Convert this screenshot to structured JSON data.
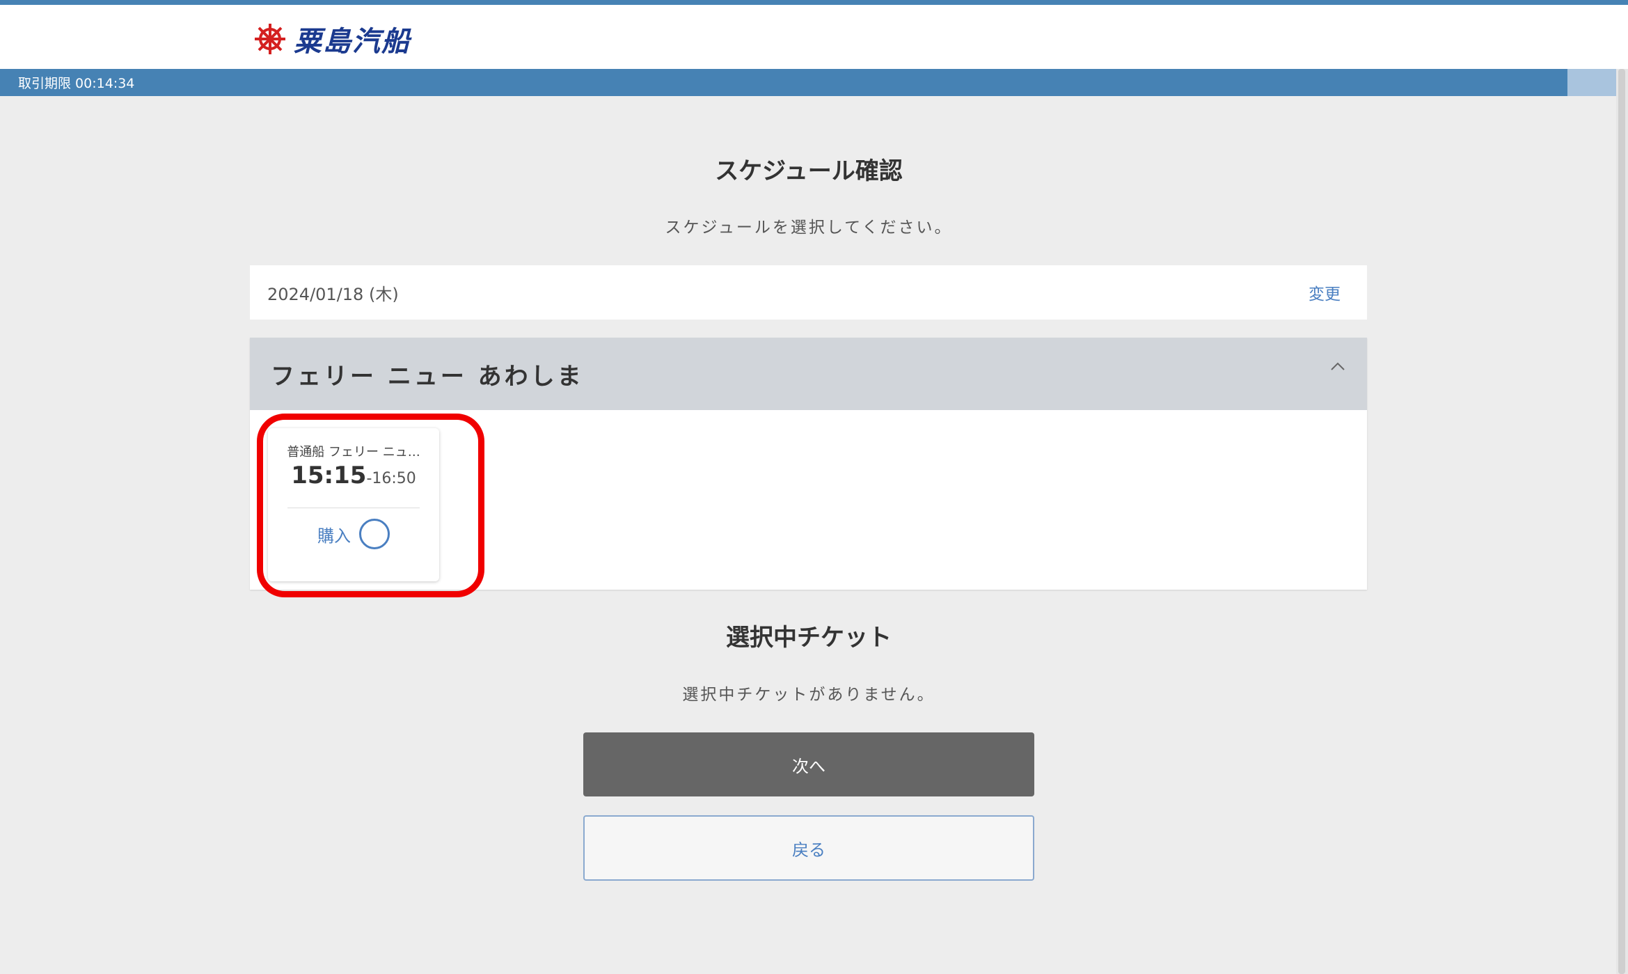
{
  "header": {
    "brand_name": "粟島汽船",
    "logo_icon": "ship-helm-icon"
  },
  "timer": {
    "label": "取引期限 00:14:34"
  },
  "schedule": {
    "title": "スケジュール確認",
    "instruction": "スケジュールを選択してください。",
    "date": "2024/01/18 (木)",
    "change_label": "変更"
  },
  "ship": {
    "name": "フェリー ニュー あわしま",
    "toggle_icon": "chevron-up-icon",
    "tickets": [
      {
        "name": "普通船 フェリー ニュ…",
        "departure": "15:15",
        "arrival": "-16:50",
        "buy_label": "購入"
      }
    ]
  },
  "selected": {
    "title": "選択中チケット",
    "empty_message": "選択中チケットがありません。"
  },
  "buttons": {
    "next_label": "次へ",
    "back_label": "戻る"
  },
  "colors": {
    "accent": "#4682b4",
    "link": "#4a7fc1",
    "highlight": "#f00000",
    "next_button": "#666666"
  }
}
